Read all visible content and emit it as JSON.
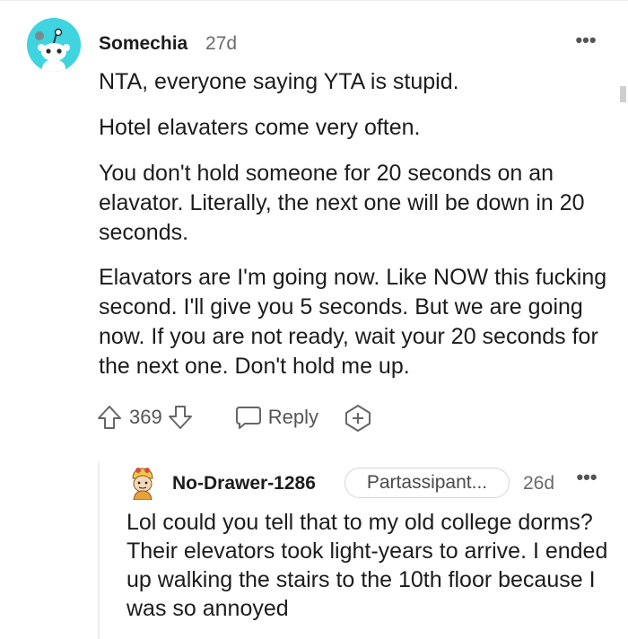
{
  "comment": {
    "author": "Somechia",
    "age": "27d",
    "more_label": "•••",
    "paragraphs": [
      "NTA, everyone saying YTA is stupid.",
      "Hotel elavaters come very often.",
      "You don't hold someone for 20 seconds on an elavator. Literally, the next one will be down in 20 seconds.",
      "Elavators are I'm going now. Like NOW this fucking second. I'll give you 5 seconds. But we are going now. If you are not ready, wait your 20 seconds for the next one. Don't hold me up."
    ],
    "votes": "369",
    "reply_label": "Reply",
    "avatar_icon": "snoo-avatar-icon",
    "avatar_color": "#3fd4e0"
  },
  "reply": {
    "author": "No-Drawer-1286",
    "flair": "Partassipant...",
    "age": "26d",
    "more_label": "•••",
    "text": "Lol could you tell that to my old college dorms? Their elevators took light-years to arrive. I ended up walking the stairs to the 10th floor because I was so annoyed",
    "avatar_icon": "cartoon-avatar-icon"
  },
  "icons": {
    "upvote": "arrow-up-icon",
    "downvote": "arrow-down-icon",
    "reply": "speech-bubble-icon",
    "award": "award-icon",
    "more": "more-dots-icon"
  }
}
